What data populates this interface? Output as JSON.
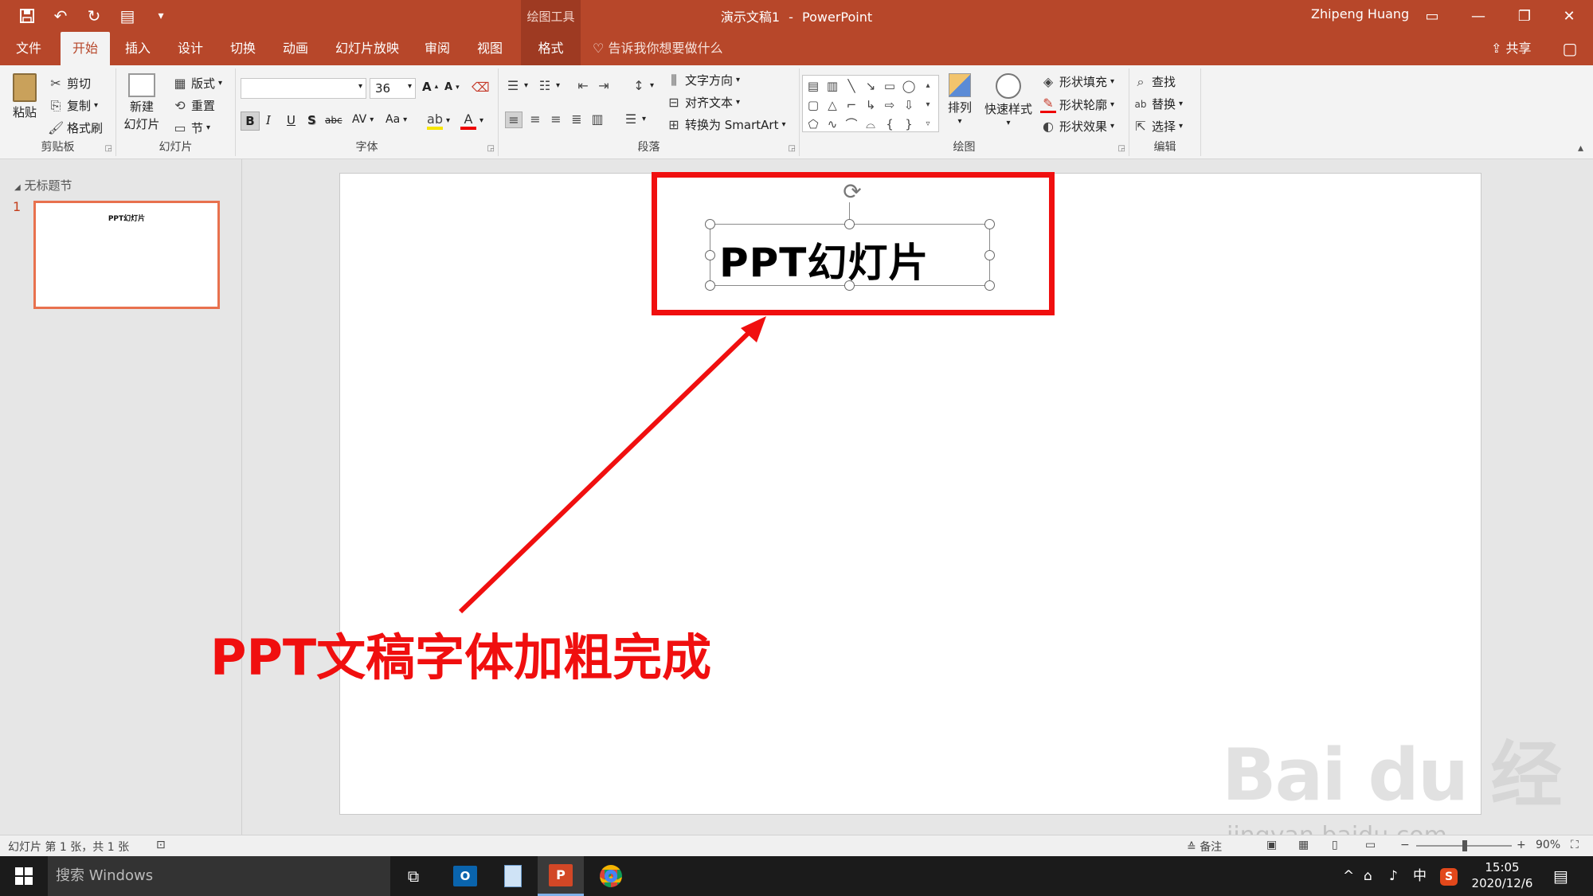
{
  "titlebar": {
    "context_tool": "绘图工具",
    "document": "演示文稿1",
    "separator": "-",
    "app": "PowerPoint",
    "user": "Zhipeng Huang"
  },
  "tabs": [
    "文件",
    "开始",
    "插入",
    "设计",
    "切换",
    "动画",
    "幻灯片放映",
    "审阅",
    "视图",
    "格式"
  ],
  "tellme": "告诉我你想要做什么",
  "share": "共享",
  "ribbon": {
    "clipboard": {
      "paste": "粘贴",
      "cut": "剪切",
      "copy": "复制",
      "format_painter": "格式刷",
      "label": "剪贴板"
    },
    "slides": {
      "new_slide_1": "新建",
      "new_slide_2": "幻灯片",
      "layout": "版式",
      "reset": "重置",
      "section": "节",
      "label": "幻灯片"
    },
    "font": {
      "font_name": "",
      "font_size": "36",
      "label": "字体",
      "bold": "B",
      "italic": "I",
      "underline": "U",
      "shadow": "S",
      "strike": "abc",
      "spacing": "AV",
      "case": "Aa",
      "grow": "A",
      "shrink": "A",
      "color": "A"
    },
    "paragraph": {
      "text_direction": "文字方向",
      "align_text": "对齐文本",
      "smartart": "转换为 SmartArt",
      "label": "段落"
    },
    "drawing": {
      "arrange": "排列",
      "quick_styles": "快速样式",
      "shape_fill": "形状填充",
      "shape_outline": "形状轮廓",
      "shape_effects": "形状效果",
      "label": "绘图"
    },
    "editing": {
      "find": "查找",
      "replace": "替换",
      "select": "选择",
      "label": "编辑"
    }
  },
  "thumbnails": {
    "section": "无标题节",
    "slide_number": "1",
    "slide_text": "PPT幻灯片"
  },
  "slide": {
    "title": "PPT幻灯片",
    "annotation": "PPT文稿字体加粗完成",
    "annotation_color": "#f00f0f"
  },
  "status": {
    "slide_info": "幻灯片 第 1 张，共 1 张",
    "notes": "备注",
    "zoom": "90%"
  },
  "taskbar": {
    "search_placeholder": "搜索 Windows",
    "ime": "中",
    "time": "15:05",
    "date": "2020/12/6"
  },
  "watermark": {
    "brand": "Bai du 经验",
    "url": "jingyan.baidu.com"
  },
  "colors": {
    "accent": "#b7472a",
    "accent_dark": "#9e3a22",
    "thumb_border": "#e8714e"
  }
}
